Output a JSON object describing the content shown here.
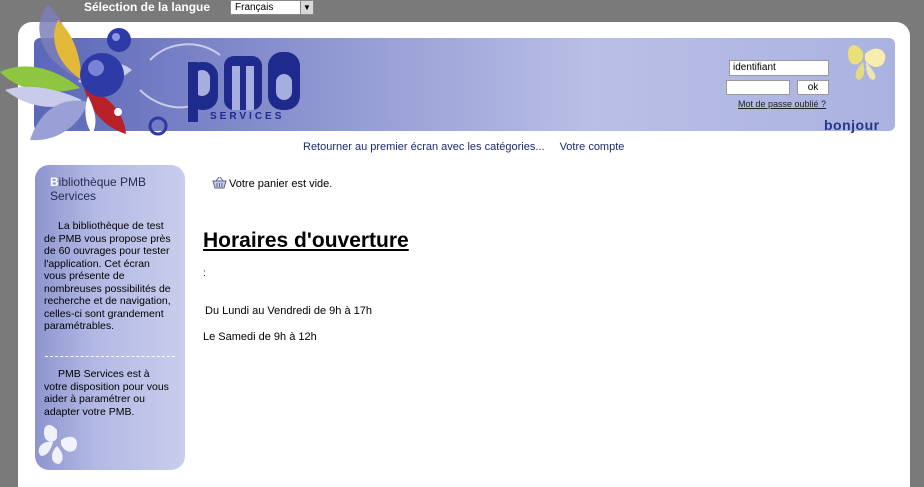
{
  "language": {
    "label": "Sélection de la langue",
    "selected": "Français"
  },
  "header": {
    "logo_text": "PMB",
    "logo_sub": "SERVICES",
    "greeting": "bonjour"
  },
  "login": {
    "id_value": "identifiant",
    "ok_label": "ok",
    "forgot_label": "Mot de passe oublié ?"
  },
  "nav": {
    "back_label": "Retourner au premier écran avec les catégories...",
    "account_label": "Votre compte"
  },
  "sidebar": {
    "title_first": "B",
    "title_rest": "ibliothèque PMB Services",
    "paragraph1": "La bibliothèque de test de PMB vous propose près de 60 ouvrages pour tester l'application. Cet écran vous présente de nombreuses possibilités de recherche et de navigation, celles-ci sont grandement paramétrables.",
    "paragraph2": "PMB Services est à votre disposition pour vous aider à paramétrer ou adapter votre PMB."
  },
  "main": {
    "basket_text": "Votre panier est vide.",
    "title": "Horaires d'ouverture",
    "colon": ":",
    "hours_weekday": "Du Lundi au Vendredi de 9h à 17h",
    "hours_saturday": "Le Samedi de 9h à 12h"
  },
  "colors": {
    "background": "#7a7a7a",
    "banner_start": "#5b67b8",
    "banner_end": "#aab2e0",
    "logo_blue": "#1e2a8c",
    "link_blue": "#1c2a6e"
  }
}
